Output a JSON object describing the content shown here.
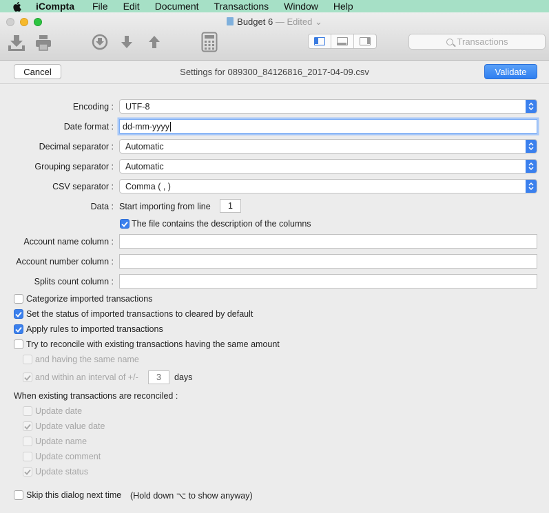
{
  "menubar": {
    "app_name": "iCompta",
    "items": [
      "File",
      "Edit",
      "Document",
      "Transactions",
      "Window",
      "Help"
    ]
  },
  "window": {
    "title": "Budget 6",
    "edited": "— Edited",
    "search_placeholder": "Transactions"
  },
  "sheet": {
    "cancel_label": "Cancel",
    "title": "Settings for 089300_84126816_2017-04-09.csv",
    "validate_label": "Validate"
  },
  "form": {
    "encoding_label": "Encoding :",
    "encoding_value": "UTF-8",
    "date_format_label": "Date format :",
    "date_format_value": "dd-mm-yyyy",
    "decimal_label": "Decimal separator :",
    "decimal_value": "Automatic",
    "grouping_label": "Grouping separator :",
    "grouping_value": "Automatic",
    "csv_label": "CSV separator :",
    "csv_value": "Comma ( , )",
    "data_label": "Data :",
    "start_line_text": "Start importing from line",
    "start_line_value": "1",
    "header_checkbox": "The file contains the description of the columns",
    "account_name_label": "Account name column :",
    "account_number_label": "Account number column :",
    "splits_label": "Splits count column :"
  },
  "options": {
    "categorize": "Categorize imported transactions",
    "cleared": "Set the status of imported transactions to cleared by default",
    "rules": "Apply rules to imported transactions",
    "reconcile": "Try to reconcile with existing transactions having the same amount",
    "same_name": "and having the same name",
    "interval": "and within an interval of +/-",
    "interval_value": "3",
    "days": "days"
  },
  "reconciled": {
    "heading": "When existing transactions are reconciled :",
    "update_date": "Update date",
    "update_value_date": "Update value date",
    "update_name": "Update name",
    "update_comment": "Update comment",
    "update_status": "Update status"
  },
  "skip": {
    "label": "Skip this dialog next time",
    "hint": "(Hold down ⌥ to show anyway)"
  },
  "colors": {
    "accent": "#3b80ed",
    "menubar": "#a6e0c6"
  }
}
